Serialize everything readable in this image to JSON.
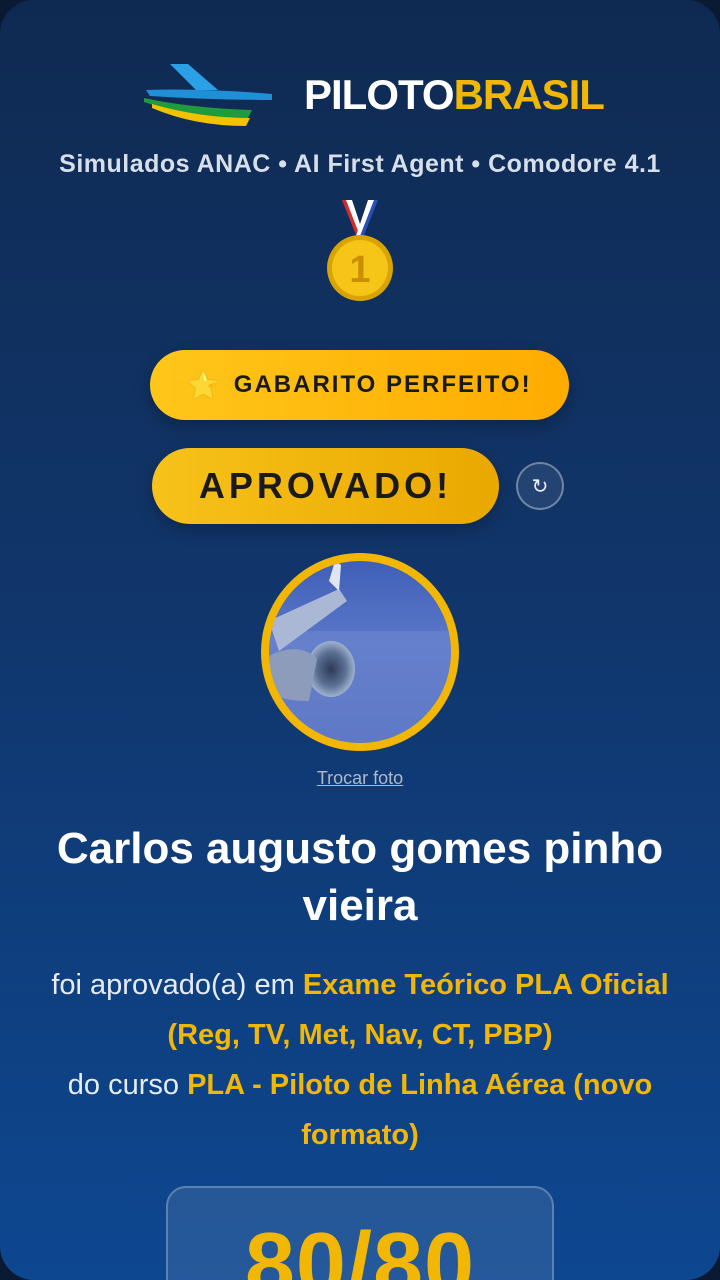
{
  "brand": {
    "name_part1": "PILOTO",
    "name_part2": "BRASIL"
  },
  "subtitle": "Simulados ANAC • AI First Agent • Comodore 4.1",
  "medal": {
    "icon": "first-place-medal-icon",
    "number": "1"
  },
  "badges": {
    "perfect_icon": "⭐",
    "perfect_label": "GABARITO PERFEITO!",
    "approved_label": "APROVADO!",
    "refresh_icon": "↻"
  },
  "profile": {
    "change_photo_label": "Trocar foto",
    "name": "Carlos augusto gomes pinho vieira"
  },
  "result": {
    "prefix": "foi aprovado(a) em",
    "exam": "Exame Teórico PLA Oficial (Reg, TV, Met, Nav, CT, PBP)",
    "course_prefix": "do curso",
    "course": "PLA - Piloto de Linha Aérea (novo formato)"
  },
  "score": "80/80",
  "colors": {
    "accent": "#f2b705",
    "background_top": "#0f2a52",
    "background_bottom": "#0d4790"
  }
}
